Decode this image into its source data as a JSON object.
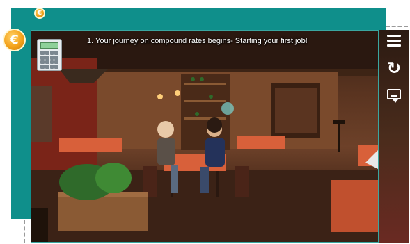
{
  "caption": {
    "text": "1. Your journey on compound rates begins- Starting your first job!"
  },
  "coins": {
    "small_symbol": "€",
    "large_symbol": "€"
  },
  "controls": {
    "menu_icon": "hamburger-menu-icon",
    "restart_icon": "restart-icon",
    "restart_glyph": "↻",
    "subtitles_icon": "subtitles-icon",
    "calculator_icon": "calculator-icon"
  },
  "colors": {
    "frame_teal": "#0f8f8b",
    "coin_gold": "#f4a21a",
    "tablecloth_red": "#d8603a",
    "wall_brown": "#6d4129"
  },
  "scene": {
    "description_elements": [
      "restaurant-room",
      "bar-shelves",
      "two-diners-at-table",
      "planter",
      "empty-tables",
      "menu-stand"
    ]
  }
}
